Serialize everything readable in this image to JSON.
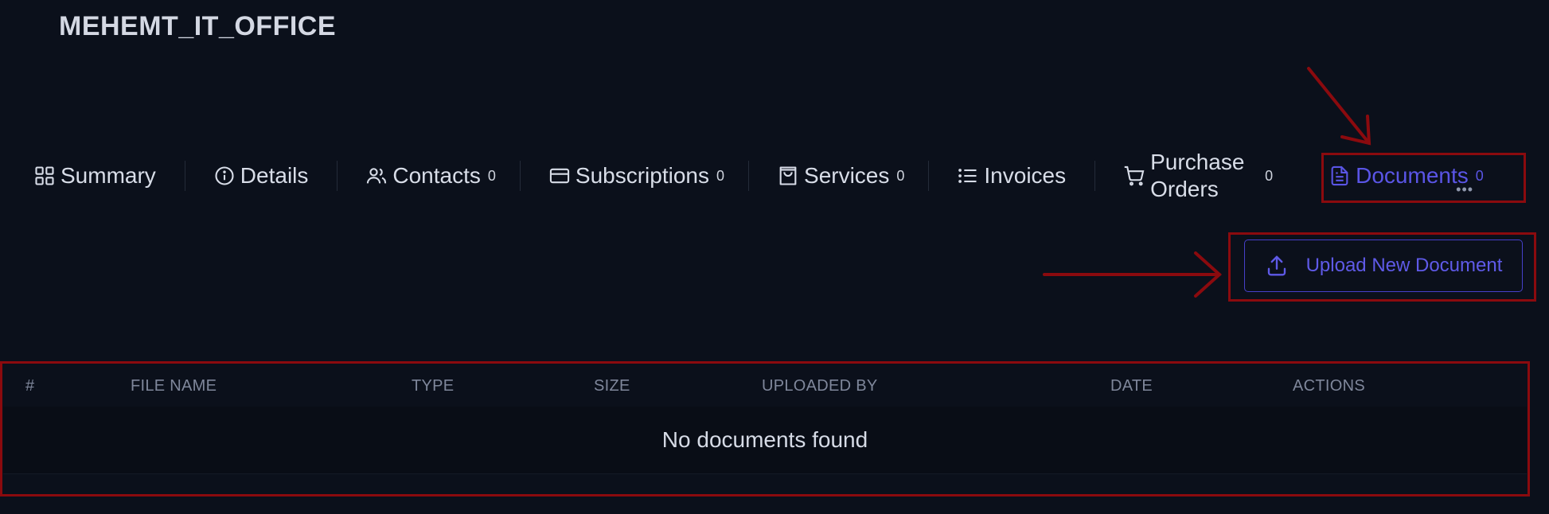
{
  "header": {
    "title": "MEHEMT_IT_OFFICE"
  },
  "tabs": [
    {
      "label": "Summary",
      "icon": "grid-icon",
      "count": ""
    },
    {
      "label": "Details",
      "icon": "info-icon",
      "count": ""
    },
    {
      "label": "Contacts",
      "icon": "users-icon",
      "count": "0"
    },
    {
      "label": "Subscriptions",
      "icon": "credit-card-icon",
      "count": "0"
    },
    {
      "label": "Services",
      "icon": "shopping-bag-icon",
      "count": "0"
    },
    {
      "label": "Invoices",
      "icon": "list-icon",
      "count": ""
    },
    {
      "label": "Purchase Orders",
      "icon": "cart-icon",
      "count": "0"
    },
    {
      "label": "Documents",
      "icon": "file-icon",
      "count": "0",
      "active": true
    }
  ],
  "upload": {
    "label": "Upload New Document",
    "icon": "upload-icon"
  },
  "table": {
    "columns": [
      "#",
      "FILE NAME",
      "TYPE",
      "SIZE",
      "UPLOADED BY",
      "DATE",
      "ACTIONS"
    ],
    "empty_message": "No documents found"
  },
  "colors": {
    "background": "#0b101b",
    "accent": "#5a55e6",
    "annotation": "#8b0a0e"
  }
}
